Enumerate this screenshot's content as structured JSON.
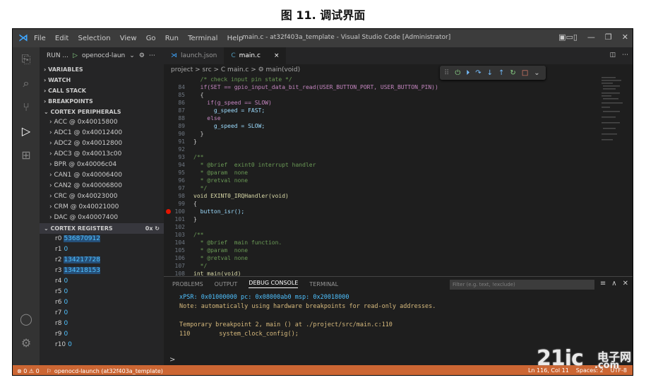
{
  "caption": "图 11. 调试界面",
  "titlebar": {
    "menu": [
      "File",
      "Edit",
      "Selection",
      "View",
      "Go",
      "Run",
      "Terminal",
      "Help"
    ],
    "window_title": "main.c - at32f403a_template - Visual Studio Code [Administrator]"
  },
  "sidebar": {
    "run_label": "RUN ...",
    "launch_config": "openocd-laun",
    "sections": [
      "VARIABLES",
      "WATCH",
      "CALL STACK",
      "BREAKPOINTS",
      "CORTEX PERIPHERALS"
    ],
    "peripherals": [
      "ACC @ 0x40015800",
      "ADC1 @ 0x40012400",
      "ADC2 @ 0x40012800",
      "ADC3 @ 0x40013c00",
      "BPR @ 0x40006c04",
      "CAN1 @ 0x40006400",
      "CAN2 @ 0x40006800",
      "CRC @ 0x40023000",
      "CRM @ 0x40021000",
      "DAC @ 0x40007400"
    ],
    "registers_header": "CORTEX REGISTERS",
    "registers_format": "0x",
    "registers": [
      {
        "name": "r0",
        "value": "536870912"
      },
      {
        "name": "r1",
        "value": "0"
      },
      {
        "name": "r2",
        "value": "134217728"
      },
      {
        "name": "r3",
        "value": "134218153"
      },
      {
        "name": "r4",
        "value": "0"
      },
      {
        "name": "r5",
        "value": "0"
      },
      {
        "name": "r6",
        "value": "0"
      },
      {
        "name": "r7",
        "value": "0"
      },
      {
        "name": "r8",
        "value": "0"
      },
      {
        "name": "r9",
        "value": "0"
      },
      {
        "name": "r10",
        "value": "0"
      }
    ]
  },
  "tabs": [
    {
      "label": "launch.json",
      "icon": "json-icon"
    },
    {
      "label": "main.c",
      "icon": "c-file-icon",
      "close": "×"
    }
  ],
  "breadcrumbs": "project > src > C main.c > ⚙ main(void)",
  "code_lines": [
    {
      "n": "",
      "text": "  /* check input pin state */"
    },
    {
      "n": "84",
      "text": "  if(SET == gpio_input_data_bit_read(USER_BUTTON_PORT, USER_BUTTON_PIN))"
    },
    {
      "n": "85",
      "text": "  {"
    },
    {
      "n": "86",
      "text": "    if(g_speed == SLOW)"
    },
    {
      "n": "87",
      "text": "      g_speed = FAST;"
    },
    {
      "n": "88",
      "text": "    else"
    },
    {
      "n": "89",
      "text": "      g_speed = SLOW;"
    },
    {
      "n": "90",
      "text": "  }"
    },
    {
      "n": "91",
      "text": "}"
    },
    {
      "n": "92",
      "text": ""
    },
    {
      "n": "93",
      "text": "/**"
    },
    {
      "n": "94",
      "text": "  * @brief  exint0 interrupt handler"
    },
    {
      "n": "95",
      "text": "  * @param  none"
    },
    {
      "n": "96",
      "text": "  * @retval none"
    },
    {
      "n": "97",
      "text": "  */"
    },
    {
      "n": "98",
      "text": "void EXINT0_IRQHandler(void)"
    },
    {
      "n": "99",
      "text": "{"
    },
    {
      "n": "100",
      "text": "  button_isr();"
    },
    {
      "n": "101",
      "text": "}"
    },
    {
      "n": "102",
      "text": ""
    },
    {
      "n": "103",
      "text": "/**"
    },
    {
      "n": "104",
      "text": "  * @brief  main function."
    },
    {
      "n": "105",
      "text": "  * @param  none"
    },
    {
      "n": "106",
      "text": "  * @retval none"
    },
    {
      "n": "107",
      "text": "  */"
    },
    {
      "n": "108",
      "text": "int main(void)"
    }
  ],
  "panel": {
    "tabs": [
      "PROBLEMS",
      "OUTPUT",
      "DEBUG CONSOLE",
      "TERMINAL"
    ],
    "active_tab": "DEBUG CONSOLE",
    "filter_placeholder": "Filter (e.g. text, !exclude)",
    "output": [
      "xPSR: 0x01000000 pc: 0x08000ab0 msp: 0x20018000",
      "Note: automatically using hardware breakpoints for read-only addresses.",
      "",
      "Temporary breakpoint 2, main () at ./project/src/main.c:110",
      "110        system_clock_config();"
    ],
    "prompt": ">"
  },
  "statusbar": {
    "problems": "⊗ 0 ⚠ 0",
    "launch": "openocd-launch (at32f403a_template)",
    "position": "Ln 116, Col 11",
    "spaces": "Spaces: 2",
    "encoding": "UTF-8"
  },
  "watermark": {
    "logo": "21ic",
    "cn": "电子网",
    "url": ".com"
  },
  "colors": {
    "statusbar": "#cc6633",
    "accent": "#3ea6ff",
    "register_value": "#4fc1ff"
  }
}
